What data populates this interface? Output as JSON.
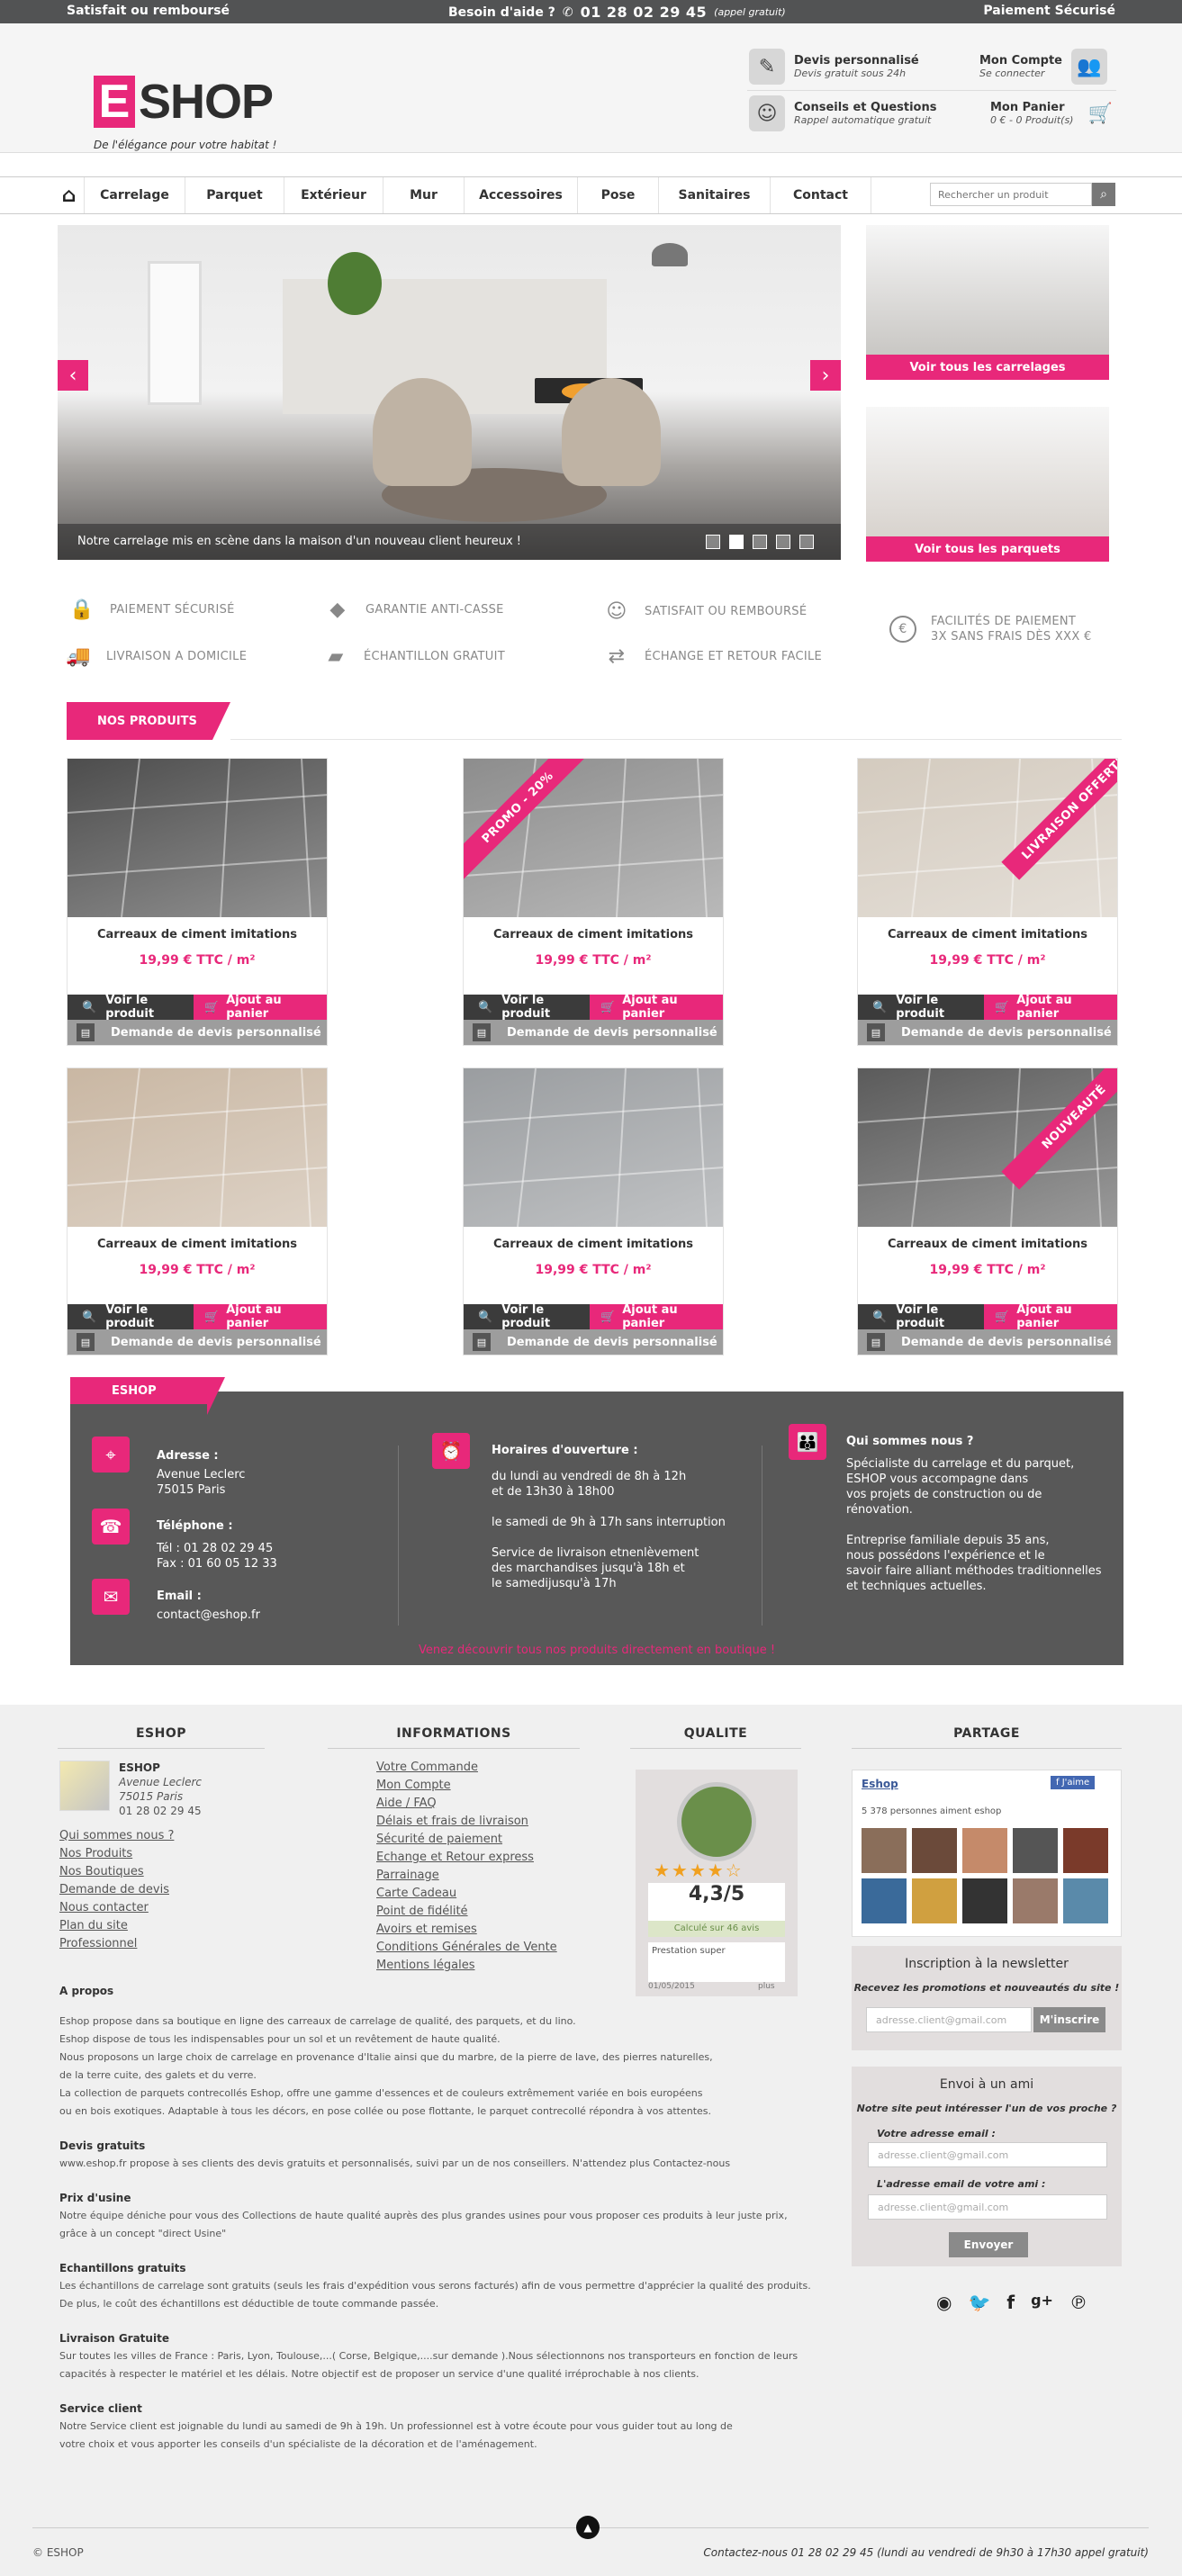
{
  "topbar": {
    "left": "Satisfait ou remboursé",
    "help": "Besoin d'aide ?",
    "phone": "01 28 02 29 45",
    "phone_note": "(appel gratuit)",
    "right": "Paiement Sécurisé"
  },
  "header": {
    "logo_e": "E",
    "logo_rest": "SHOP",
    "tagline": "De l'élégance pour votre habitat !",
    "devis_title": "Devis personnalisé",
    "devis_sub": "Devis gratuit sous 24h",
    "account_title": "Mon Compte",
    "account_sub": "Se connecter",
    "conseil_title": "Conseils et Questions",
    "conseil_sub": "Rappel automatique gratuit",
    "cart_title": "Mon Panier",
    "cart_sub": "0 € - 0 Produit(s)"
  },
  "nav": {
    "items": [
      "Carrelage",
      "Parquet",
      "Extérieur",
      "Mur",
      "Accessoires",
      "Pose",
      "Sanitaires",
      "Contact"
    ],
    "search_placeholder": "Rechercher un produit"
  },
  "hero": {
    "caption": "Notre carrelage mis en scène dans la maison d'un nouveau client heureux !",
    "slides": 5,
    "active": 2
  },
  "promos": [
    {
      "label": "Voir tous les carrelages"
    },
    {
      "label": "Voir tous les parquets"
    }
  ],
  "features": [
    "PAIEMENT SÉCURISÉ",
    "GARANTIE ANTI-CASSE",
    "SATISFAIT OU REMBOURSÉ",
    "FACILITÉS DE PAIEMENT",
    "3X SANS FRAIS DÈS XXX €",
    "LIVRAISON A DOMICILE",
    "ÉCHANTILLON GRATUIT",
    "ÉCHANGE ET RETOUR FACILE"
  ],
  "products_title": "NOS PRODUITS",
  "products": [
    {
      "name": "Carreaux de ciment imitations",
      "price": "19,99 € TTC / m²",
      "ribbon": "",
      "tone": "#4d4d4d"
    },
    {
      "name": "Carreaux de ciment imitations",
      "price": "19,99 € TTC / m²",
      "ribbon": "PROMO - 20%",
      "tone": "#8d8d8d"
    },
    {
      "name": "Carreaux de ciment imitations",
      "price": "19,99 € TTC / m²",
      "ribbon": "LIVRAISON OFFERTE",
      "tone": "#d4cbbf"
    },
    {
      "name": "Carreaux de ciment imitations",
      "price": "19,99 € TTC / m²",
      "ribbon": "",
      "tone": "#c9b7a3"
    },
    {
      "name": "Carreaux de ciment imitations",
      "price": "19,99 € TTC / m²",
      "ribbon": "",
      "tone": "#9a9da0"
    },
    {
      "name": "Carreaux de ciment imitations",
      "price": "19,99 € TTC / m²",
      "ribbon": "NOUVEAUTÉ",
      "tone": "#5b5b5b"
    }
  ],
  "product_buttons": {
    "see": "Voir le produit",
    "add": "Ajout au panier",
    "devis": "Demande de devis personnalisé"
  },
  "eshop_title": "ESHOP",
  "info": {
    "addr_label": "Adresse :",
    "addr_lines": [
      "Avenue Leclerc",
      "75015 Paris"
    ],
    "tel_label": "Téléphone :",
    "tel_lines": [
      "Tél : 01 28 02 29 45",
      "Fax : 01 60 05 12 33"
    ],
    "email_label": "Email :",
    "email": "contact@eshop.fr",
    "hours_label": "Horaires d'ouverture :",
    "hours_lines": [
      "du lundi au vendredi de 8h à 12h",
      "et de 13h30 à 18h00",
      "",
      "le samedi de 9h à 17h sans interruption",
      "",
      "Service de livraison etnenlèvement",
      "des marchandises jusqu'à 18h et",
      "le samedijusqu'à 17h"
    ],
    "who_label": "Qui sommes nous ?",
    "who_lines": [
      "Spécialiste du carrelage et du parquet,",
      "ESHOP vous accompagne dans",
      "vos projets de construction ou de",
      "rénovation.",
      "",
      "Entreprise familiale depuis 35 ans,",
      "nous possédons l'expérience et le",
      "savoir faire alliant méthodes traditionnelles",
      "et techniques actuelles."
    ],
    "cta": "Venez découvrir tous nos produits directement en boutique !"
  },
  "footer": {
    "col1_title": "ESHOP",
    "col2_title": "INFORMATIONS",
    "col3_title": "QUALITE",
    "col4_title": "PARTAGE",
    "shop_name": "ESHOP",
    "shop_addr": [
      "Avenue Leclerc",
      "75015 Paris",
      "01 28 02 29 45"
    ],
    "links1": [
      "Qui sommes nous ?",
      "Nos Produits",
      "Nos Boutiques",
      "Demande de devis",
      "Nous contacter",
      "Plan du site",
      "Professionnel"
    ],
    "links2": [
      "Votre Commande",
      "Mon Compte",
      "Aide / FAQ",
      "Délais et frais de livraison",
      "Sécurité de paiement",
      "Echange et Retour express",
      "Parrainage",
      "Carte Cadeau",
      "Point de fidélité",
      "Avoirs et remises",
      "Conditions Générales de Vente",
      "Mentions légales"
    ],
    "rating": "4,3/5",
    "rating_sub": "Calculé sur 46 avis",
    "review": "Prestation super",
    "review_date": "01/05/2015",
    "review_more": "plus",
    "fb_name": "Eshop",
    "fb_like": "J'aime",
    "fb_count": "5 378 personnes aiment eshop",
    "newsletter_title": "Inscription à la newsletter",
    "newsletter_sub": "Recevez les promotions et nouveautés du site !",
    "newsletter_placeholder": "adresse.client@gmail.com",
    "newsletter_btn": "M'inscrire",
    "friend_title": "Envoi à un ami",
    "friend_q": "Notre site peut intéresser l'un de vos proche ?",
    "friend_l1": "Votre adresse email :",
    "friend_l2": "L'adresse email de votre ami :",
    "friend_placeholder": "adresse.client@gmail.com",
    "friend_btn": "Envoyer",
    "apropos_title": "A propos",
    "apropos_lines": [
      "Eshop propose dans sa boutique en ligne des carreaux de carrelage de qualité, des parquets, et du lino.",
      "Eshop dispose de tous les indispensables pour un sol et un revêtement de haute qualité.",
      "Nous proposons un large choix de carrelage en provenance d'Italie ainsi que du marbre, de la pierre de lave, des pierres naturelles,",
      "de la terre cuite, des galets et du verre.",
      "La collection de parquets contrecollés Eshop, offre une gamme d'essences et de couleurs extrêmement variée en bois européens",
      "ou en bois exotiques. Adaptable à tous les décors, en pose collée ou pose flottante, le parquet contrecollé répondra à vos attentes."
    ],
    "sections": [
      {
        "h": "Devis gratuits",
        "lines": [
          "www.eshop.fr propose à ses clients des devis gratuits et personnalisés, suivi par un de nos conseillers. N'attendez plus Contactez-nous"
        ]
      },
      {
        "h": "Prix d'usine",
        "lines": [
          "Notre équipe déniche pour vous des Collections de haute qualité auprès des plus grandes usines pour vous proposer ces produits à leur juste prix,",
          "grâce à un concept  \"direct Usine\""
        ]
      },
      {
        "h": "Echantillons gratuits",
        "lines": [
          "Les échantillons de carrelage sont gratuits (seuls les frais d'expédition vous serons facturés) afin de vous permettre d'apprécier la qualité des produits.",
          "De plus, le coût des échantillons est déductible de toute commande passée."
        ]
      },
      {
        "h": "Livraison Gratuite",
        "lines": [
          "Sur toutes les villes de France : Paris, Lyon, Toulouse,...( Corse, Belgique,....sur demande ).Nous sélectionnons nos transporteurs en fonction de leurs",
          "capacités à respecter le matériel et les délais. Notre objectif est de proposer un service d'une qualité irréprochable à nos clients."
        ]
      },
      {
        "h": "Service client",
        "lines": [
          "Notre Service client est joignable du lundi au samedi de 9h à 19h. Un professionnel est à votre écoute pour vous guider tout au long de",
          "votre choix et vous apporter les conseils d'un spécialiste de la décoration et de l'aménagement."
        ]
      }
    ],
    "copyright": "© ESHOP",
    "contact_line": "Contactez-nous 01 28 02 29 45 (lundi au vendredi de 9h30 à 17h30 appel gratuit)"
  },
  "colors": {
    "accent": "#e8287a",
    "dark": "#585858",
    "top": "#525354"
  }
}
